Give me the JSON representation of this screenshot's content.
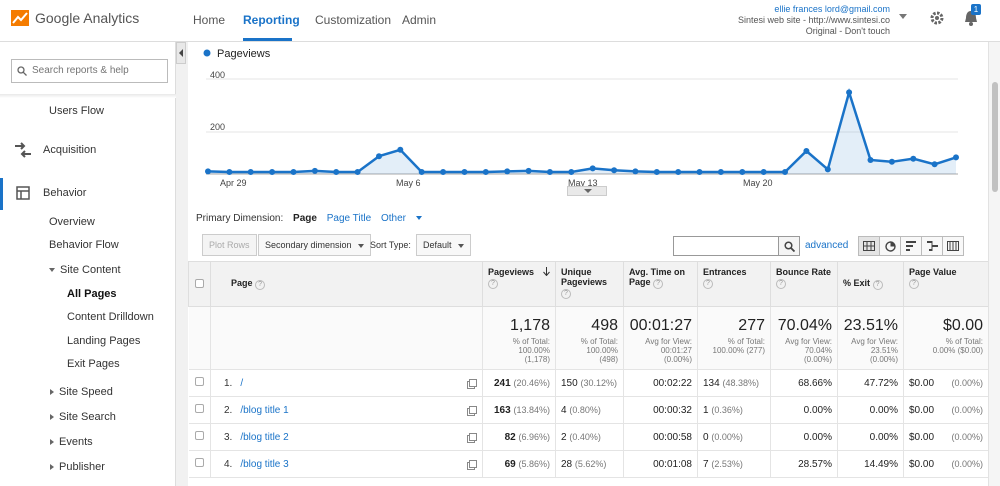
{
  "topbar": {
    "brand": "Google Analytics",
    "nav": {
      "home": "Home",
      "reporting": "Reporting",
      "customization": "Customization",
      "admin": "Admin"
    },
    "account": {
      "email": "ellie frances lord@gmail.com",
      "property": "Sintesi web site - http://www.sintesi.co",
      "view": "Original - Don't touch"
    },
    "notification_count": "1"
  },
  "sidebar": {
    "search_placeholder": "Search reports & help",
    "users_flow": "Users Flow",
    "acquisition": "Acquisition",
    "behavior": "Behavior",
    "overview": "Overview",
    "behavior_flow": "Behavior Flow",
    "site_content": "Site Content",
    "all_pages": "All Pages",
    "content_drilldown": "Content Drilldown",
    "landing_pages": "Landing Pages",
    "exit_pages": "Exit Pages",
    "site_speed": "Site Speed",
    "site_search": "Site Search",
    "events": "Events",
    "publisher": "Publisher"
  },
  "chart_data": {
    "type": "area",
    "series": [
      {
        "name": "Pageviews",
        "values": [
          10,
          8,
          8,
          8,
          8,
          12,
          8,
          8,
          70,
          95,
          8,
          8,
          8,
          8,
          10,
          12,
          8,
          8,
          22,
          15,
          10,
          8,
          8,
          8,
          8,
          8,
          8,
          8,
          8,
          8,
          8,
          8,
          8,
          8,
          8,
          8,
          8,
          8,
          8,
          8,
          8,
          8,
          8,
          8,
          8,
          8,
          8,
          8,
          8,
          8,
          8,
          8,
          8,
          8,
          8,
          8,
          8,
          8,
          8,
          8,
          8,
          8,
          8,
          8,
          8,
          8,
          8,
          8,
          8,
          8,
          8,
          8,
          8,
          8,
          8,
          8,
          8,
          8,
          8,
          8,
          8,
          8,
          8,
          8,
          8,
          8,
          8,
          8
        ]
      }
    ],
    "values": [
      10,
      8,
      8,
      8,
      8,
      12,
      8,
      8,
      70,
      95,
      8,
      8,
      8,
      8,
      10,
      12,
      8,
      8,
      22,
      15,
      10,
      8,
      8,
      8,
      8,
      8,
      8,
      8,
      8,
      8,
      8,
      8,
      8,
      8,
      8,
      8,
      8,
      8,
      8,
      8,
      8,
      8,
      8,
      8,
      8,
      8,
      8,
      8,
      8,
      8,
      8,
      8,
      8,
      8,
      8,
      8,
      8,
      8,
      8,
      8,
      8,
      8,
      8,
      8,
      8,
      8,
      8,
      8,
      8,
      8,
      8,
      8,
      8,
      8,
      8,
      8,
      8,
      8,
      8,
      8,
      8,
      8,
      8,
      8,
      8,
      8,
      8,
      8,
      8,
      8
    ],
    "points": [
      10,
      8,
      8,
      8,
      8,
      12,
      8,
      8,
      70,
      95,
      8,
      8,
      8,
      8,
      10,
      12,
      8,
      8,
      22,
      15,
      10,
      8,
      8,
      8,
      8,
      8,
      8,
      8,
      8,
      8,
      8,
      8,
      8,
      8,
      8,
      8,
      8,
      8,
      8,
      8,
      8,
      8,
      8,
      8,
      8,
      8,
      8,
      8,
      8,
      8,
      8,
      8,
      8,
      8,
      8,
      8,
      8,
      8,
      8,
      8,
      8,
      8,
      8,
      8,
      8,
      8,
      8,
      8,
      8,
      8,
      8,
      8,
      8,
      8,
      8,
      8,
      8,
      8,
      8,
      8,
      8,
      8,
      8,
      8,
      8,
      8,
      8,
      8,
      8,
      8
    ],
    "y": [
      10,
      8,
      8,
      8,
      8,
      12,
      8,
      8,
      70,
      95,
      8,
      8,
      8,
      8,
      10,
      12,
      8,
      8,
      22,
      15,
      10,
      8,
      8,
      8,
      8,
      8,
      8,
      8,
      8,
      8,
      8,
      8,
      8,
      8,
      8,
      8,
      8,
      8,
      8,
      8,
      8,
      8,
      8,
      8,
      8,
      8,
      8,
      8,
      8,
      8,
      8,
      8,
      8,
      8,
      8,
      8,
      8,
      8,
      8,
      8,
      8,
      8,
      8,
      8,
      8,
      8,
      8,
      8,
      8,
      8,
      8,
      8,
      8,
      8,
      8,
      8,
      8,
      8,
      8,
      8,
      8,
      8,
      8,
      8,
      8,
      8,
      8,
      8,
      8,
      8
    ],
    "ylim": [
      0,
      400
    ],
    "yticks": [
      "400",
      "200"
    ],
    "xticks": [
      "Apr 29",
      "May 6",
      "May 13",
      "May 20"
    ],
    "legend": "Pageviews",
    "grid": true,
    "color": "#1a73c8",
    "data": [
      10,
      8,
      8,
      8,
      8,
      12,
      8,
      8,
      70,
      95,
      8,
      8,
      8,
      8,
      10,
      12,
      8,
      8,
      22,
      15,
      10,
      8,
      8,
      8,
      8,
      8,
      8,
      8,
      8,
      8,
      8,
      8,
      8,
      8,
      8,
      8,
      8,
      8,
      8,
      8,
      8,
      8,
      8,
      8,
      8,
      8,
      8,
      8,
      8,
      8,
      8,
      8,
      8,
      8,
      8,
      8,
      8,
      8,
      8,
      8,
      8,
      8,
      8,
      8,
      8,
      8,
      8,
      8,
      8,
      8,
      8,
      8,
      8,
      8,
      8,
      8,
      8,
      8,
      8,
      8,
      8,
      8,
      8,
      8,
      8,
      8,
      8,
      8,
      8,
      8
    ],
    "daily": [
      10,
      8,
      8,
      8,
      8,
      12,
      8,
      8,
      70,
      95,
      8,
      8,
      8,
      8,
      10,
      12,
      8,
      8,
      22,
      15,
      10,
      8,
      8,
      8,
      8,
      8,
      8,
      8,
      8,
      8,
      8,
      8,
      8,
      8,
      8,
      8,
      8,
      8,
      8,
      8,
      8,
      8,
      8,
      8,
      8,
      8,
      8,
      8,
      8,
      8,
      8,
      8,
      8,
      8,
      8,
      8,
      8,
      8,
      8,
      8,
      8,
      8,
      8,
      8,
      8,
      8,
      8,
      8,
      8,
      8,
      8,
      8,
      8,
      8,
      8,
      8,
      8,
      8,
      8,
      8,
      8,
      8,
      8,
      8,
      8,
      8,
      8,
      8,
      8,
      8
    ]
  },
  "chart": {
    "values": [
      10,
      8,
      8,
      8,
      8,
      12,
      8,
      8,
      70,
      95,
      8,
      8,
      8,
      8,
      10,
      12,
      8,
      8,
      22,
      15,
      10,
      8,
      8,
      8,
      8,
      8,
      8,
      8,
      90,
      18,
      320,
      55,
      48,
      60,
      38,
      65
    ]
  },
  "dimension": {
    "label": "Primary Dimension:",
    "page": "Page",
    "page_title": "Page Title",
    "other": "Other"
  },
  "toolbar": {
    "plot_rows": "Plot Rows",
    "secondary_dimension": "Secondary dimension",
    "sort_type_label": "Sort Type:",
    "sort_type_value": "Default",
    "advanced": "advanced"
  },
  "table": {
    "headers": {
      "page": "Page",
      "pageviews": "Pageviews",
      "unique_pageviews": "Unique Pageviews",
      "avg_time": "Avg. Time on Page",
      "entrances": "Entrances",
      "bounce_rate": "Bounce Rate",
      "exit": "% Exit",
      "page_value": "Page Value"
    },
    "totals": {
      "pageviews": "1,178",
      "pageviews_sub1": "% of Total:",
      "pageviews_sub2": "100.00%",
      "pageviews_sub3": "(1,178)",
      "unique": "498",
      "unique_sub1": "% of Total:",
      "unique_sub2": "100.00%",
      "unique_sub3": "(498)",
      "avg_time": "00:01:27",
      "avg_time_sub1": "Avg for View:",
      "avg_time_sub2": "00:01:27",
      "avg_time_sub3": "(0.00%)",
      "entrances": "277",
      "entrances_sub1": "% of Total:",
      "entrances_sub2": "100.00% (277)",
      "bounce": "70.04%",
      "bounce_sub1": "Avg for View:",
      "bounce_sub2": "70.04%",
      "bounce_sub3": "(0.00%)",
      "exit": "23.51%",
      "exit_sub1": "Avg for View:",
      "exit_sub2": "23.51%",
      "exit_sub3": "(0.00%)",
      "value": "$0.00",
      "value_sub1": "% of Total:",
      "value_sub2": "0.00% ($0.00)"
    },
    "rows": [
      {
        "num": "1.",
        "page": "/",
        "pv": "241",
        "pv_pct": "(20.46%)",
        "upv": "150",
        "upv_pct": "(30.12%)",
        "time": "00:02:22",
        "ent": "134",
        "ent_pct": "(48.38%)",
        "bounce": "68.66%",
        "exit": "47.72%",
        "value": "$0.00",
        "value_pct": "(0.00%)"
      },
      {
        "num": "2.",
        "page": "/blog title 1",
        "pv": "163",
        "pv_pct": "(13.84%)",
        "upv": "4",
        "upv_pct": "(0.80%)",
        "time": "00:00:32",
        "ent": "1",
        "ent_pct": "(0.36%)",
        "bounce": "0.00%",
        "exit": "0.00%",
        "value": "$0.00",
        "value_pct": "(0.00%)"
      },
      {
        "num": "3.",
        "page": "/blog title 2",
        "pv": "82",
        "pv_pct": "(6.96%)",
        "upv": "2",
        "upv_pct": "(0.40%)",
        "time": "00:00:58",
        "ent": "0",
        "ent_pct": "(0.00%)",
        "bounce": "0.00%",
        "exit": "0.00%",
        "value": "$0.00",
        "value_pct": "(0.00%)"
      },
      {
        "num": "4.",
        "page": "/blog title 3",
        "pv": "69",
        "pv_pct": "(5.86%)",
        "upv": "28",
        "upv_pct": "(5.62%)",
        "time": "00:01:08",
        "ent": "7",
        "ent_pct": "(2.53%)",
        "bounce": "28.57%",
        "exit": "14.49%",
        "value": "$0.00",
        "value_pct": "(0.00%)"
      }
    ]
  }
}
